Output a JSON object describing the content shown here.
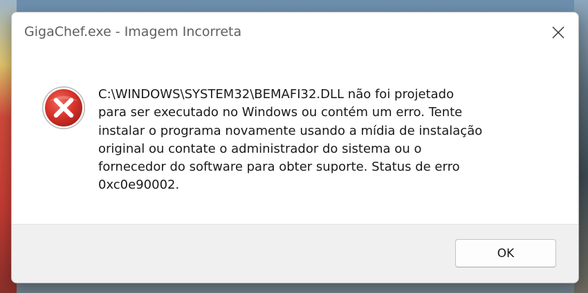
{
  "dialog": {
    "title": "GigaChef.exe - Imagem Incorreta",
    "close_icon": "close-icon",
    "icon": "error-icon",
    "message": "C:\\WINDOWS\\SYSTEM32\\BEMAFI32.DLL não foi projetado\npara ser executado no Windows ou contém um erro. Tente\ninstalar o programa novamente usando a mídia de instalação\noriginal ou contate o administrador do sistema ou o\nfornecedor do software para obter suporte. Status de erro\n0xc0e90002.",
    "ok_label": "OK"
  },
  "colors": {
    "error_red": "#d9342b",
    "title_text": "#5f5f5f",
    "footer_bg": "#f0f0f0"
  }
}
